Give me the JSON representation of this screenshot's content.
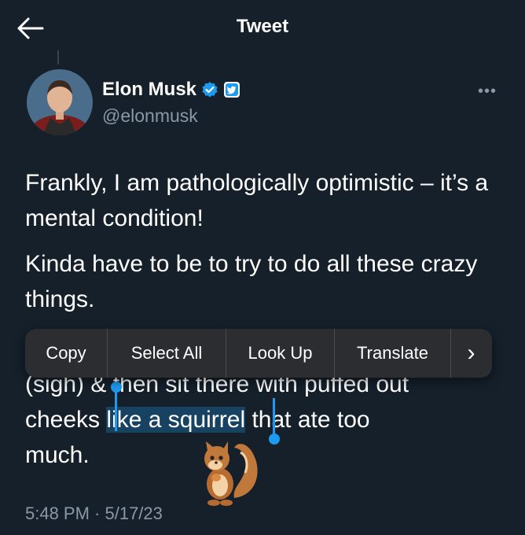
{
  "header": {
    "title": "Tweet",
    "back_icon": "back-arrow-icon"
  },
  "author": {
    "name": "Elon Musk",
    "handle": "@elonmusk",
    "verified_icon": "verified-badge-icon",
    "affiliate_icon": "twitter-affiliate-badge-icon"
  },
  "tweet": {
    "paragraph1": "Frankly, I am pathologically optimistic – it’s a mental condition!",
    "paragraph2": "Kinda have to be to try to do all these crazy things.",
    "p3_line1": "(sigh) & then sit there with puffed out",
    "p3_before": "cheeks ",
    "p3_selected": "like a squirrel",
    "p3_after": " that ate too",
    "p3_line3": "much.",
    "timestamp": "5:48 PM · 5/17/23"
  },
  "context_menu": {
    "copy": "Copy",
    "select_all": "Select All",
    "look_up": "Look Up",
    "translate": "Translate",
    "more": "›"
  },
  "colors": {
    "background": "#15202b",
    "accent": "#1d9bf0",
    "secondary_text": "#8b98a5",
    "menu_bg": "#2b2d31"
  }
}
